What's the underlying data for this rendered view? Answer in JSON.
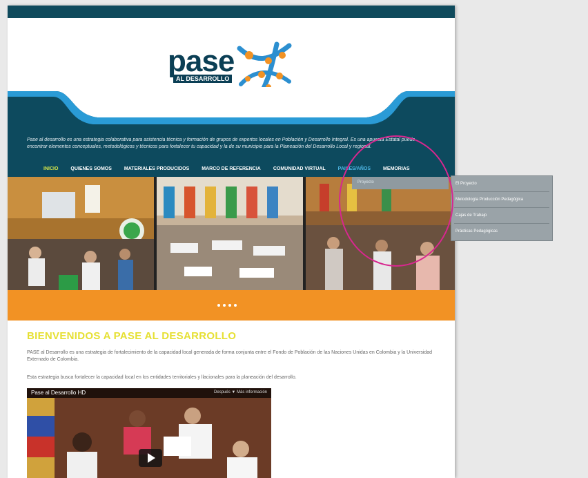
{
  "site": {
    "logo_word": "pase",
    "logo_sub": "AL DESARROLLO",
    "intro_text": "Pase al desarrollo es una estrategia colaborativa para asistencia técnica y formación de grupos de expertos locales en Población y Desarrollo Integral. Es una apuesta Estatal puede encontrar elementos conceptuales, metodológicos y técnicos para fortalecer tu capacidad y la de su municipio para la Planeación del Desarrollo Local y regional.",
    "nav": [
      {
        "label": "INICIO"
      },
      {
        "label": "QUIENES SOMOS"
      },
      {
        "label": "MATERIALES PRODUCIDOS"
      },
      {
        "label": "MARCO DE REFERENCIA"
      },
      {
        "label": "COMUNIDAD VIRTUAL"
      },
      {
        "label": "PAISES/AÑOS"
      },
      {
        "label": "MEMORIAS"
      }
    ],
    "dropdown_first": "Proyecto",
    "submenu": [
      {
        "label": "El Proyecto"
      },
      {
        "label": "Metodología Producción Pedagógica"
      },
      {
        "label": "Cajas de Trabajo"
      },
      {
        "label": "Prácticas Pedagógicas"
      }
    ],
    "welcome_title": "BIENVENIDOS A PASE AL DESARROLLO",
    "para1": "PASE al Desarrollo es una estrategia de fortalecimiento de la capacidad local generada de forma conjunta entre el Fondo de Población de las Naciones Unidas en Colombia y la Universidad Externado de Colombia.",
    "para2": "Esta estrategia busca fortalecer la capacidad local en los entidades territoriales y llacionales para la planeación del desarrollo.",
    "video": {
      "title": "Pase al Desarrollo HD",
      "right_text": "Después ▼  Más información"
    }
  },
  "colors": {
    "topbar": "#0f4a5c",
    "teal": "#0d4a5e",
    "orange": "#f29224",
    "highlight": "#d8278f",
    "welcome": "#e6e033"
  }
}
